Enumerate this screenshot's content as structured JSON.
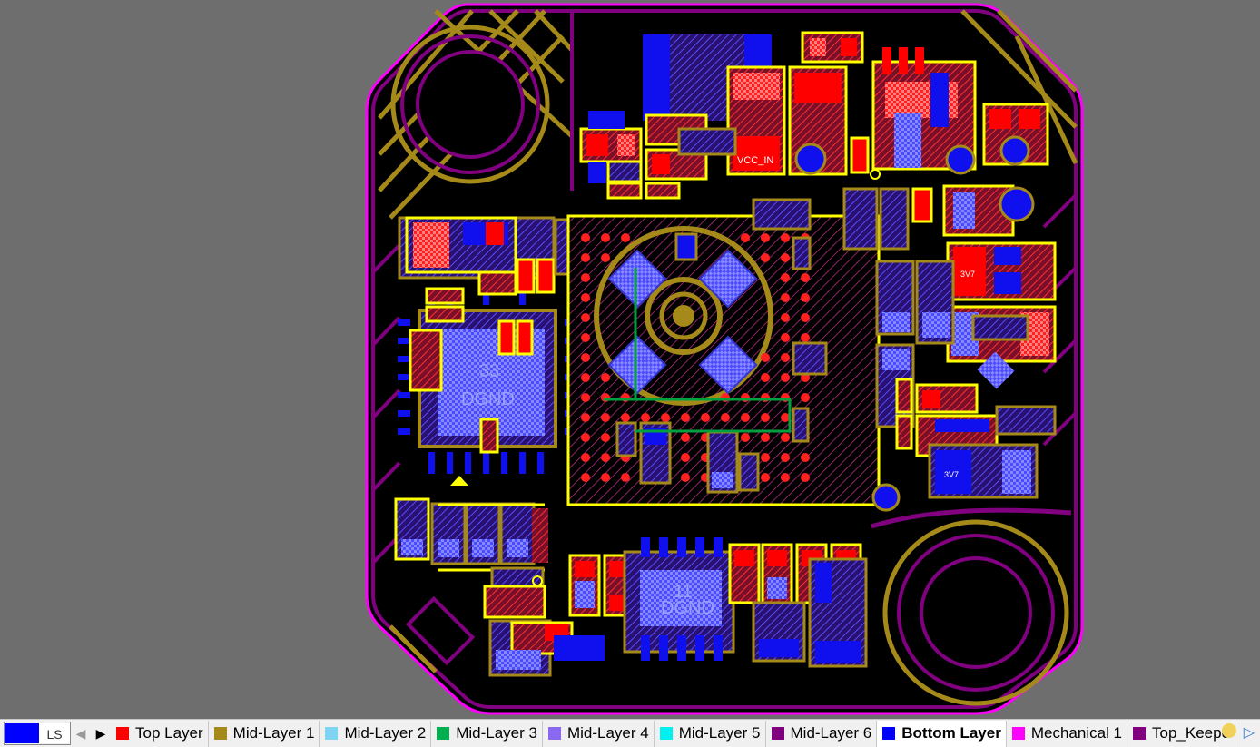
{
  "colors": {
    "top": "#ff0000",
    "bottom": "#1010ee",
    "mid1": "#a58a1a",
    "mech": "#ff00ff",
    "keepout": "#800080",
    "highlight": "#ffff00",
    "board": "#000000",
    "workspace": "#6e6e6e",
    "label": "#9aa0ff"
  },
  "pcb": {
    "labels": {
      "pad33": "33",
      "dgnd": "DGND",
      "vcc_in": "VCC_IN",
      "pad11": "11",
      "n3v7": "3V7"
    }
  },
  "layer_bar": {
    "current": "LS",
    "tabs": [
      {
        "label": "Top Layer",
        "color": "#ff0000"
      },
      {
        "label": "Mid-Layer 1",
        "color": "#a58a1a"
      },
      {
        "label": "Mid-Layer 2",
        "color": "#7fd4f4"
      },
      {
        "label": "Mid-Layer 3",
        "color": "#00b050"
      },
      {
        "label": "Mid-Layer 4",
        "color": "#8a68f0"
      },
      {
        "label": "Mid-Layer 5",
        "color": "#00f0f0"
      },
      {
        "label": "Mid-Layer 6",
        "color": "#800080"
      },
      {
        "label": "Bottom Layer",
        "color": "#0000ff",
        "active": true
      },
      {
        "label": "Mechanical 1",
        "color": "#ff00ff"
      },
      {
        "label": "Top_Keepo",
        "color": "#800080"
      }
    ]
  }
}
